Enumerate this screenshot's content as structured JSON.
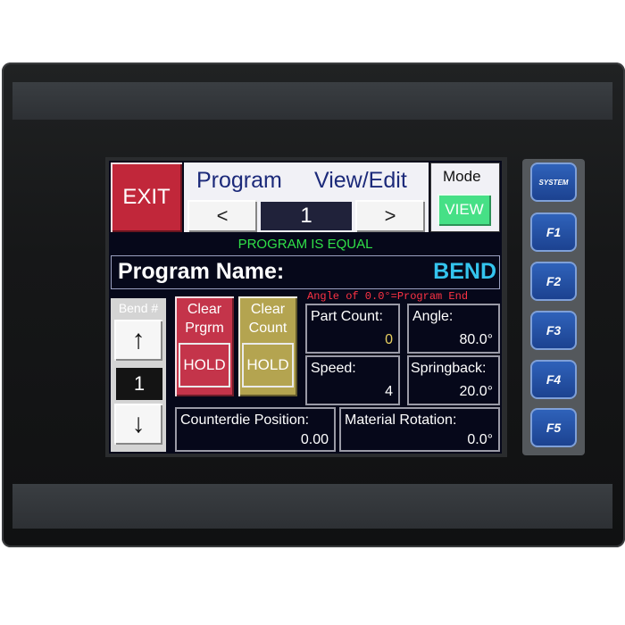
{
  "header": {
    "exit_label": "EXIT",
    "program_label": "Program",
    "view_edit_label": "View/Edit",
    "prev_label": "<",
    "next_label": ">",
    "program_number": "1",
    "mode_label": "Mode",
    "mode_value": "VIEW"
  },
  "status": {
    "message": "PROGRAM IS EQUAL",
    "color": "#30e048"
  },
  "program_name": {
    "label": "Program Name:",
    "value": "BEND"
  },
  "bend": {
    "label": "Bend #",
    "up_glyph": "↑",
    "down_glyph": "↓",
    "value": "1"
  },
  "clear_program": {
    "label_line1": "Clear",
    "label_line2": "Prgrm",
    "hold_label": "HOLD",
    "color": "#c4344a"
  },
  "clear_count": {
    "label_line1": "Clear",
    "label_line2": "Count",
    "hold_label": "HOLD",
    "color": "#b4a450"
  },
  "note": "Angle of 0.0°=Program End",
  "fields": {
    "part_count": {
      "label": "Part Count:",
      "value": "0",
      "value_color": "#e8d060"
    },
    "angle": {
      "label": "Angle:",
      "value": "80.0°"
    },
    "speed": {
      "label": "Speed:",
      "value": "4"
    },
    "springback": {
      "label": "Springback:",
      "value": "20.0°"
    },
    "counterdie_position": {
      "label": "Counterdie Position:",
      "value": "0.00"
    },
    "material_rotation": {
      "label": "Material Rotation:",
      "value": "0.0°"
    }
  },
  "function_keys": [
    {
      "label": "SYSTEM",
      "icon": "system-key"
    },
    {
      "label": "F1"
    },
    {
      "label": "F2"
    },
    {
      "label": "F3"
    },
    {
      "label": "F4"
    },
    {
      "label": "F5"
    }
  ],
  "colors": {
    "screen_bg": "#06081a",
    "exit_red": "#c1273a",
    "program_name_value": "#34c4ee",
    "note_red": "#ff3344",
    "fkey_blue": "#2050a8"
  }
}
